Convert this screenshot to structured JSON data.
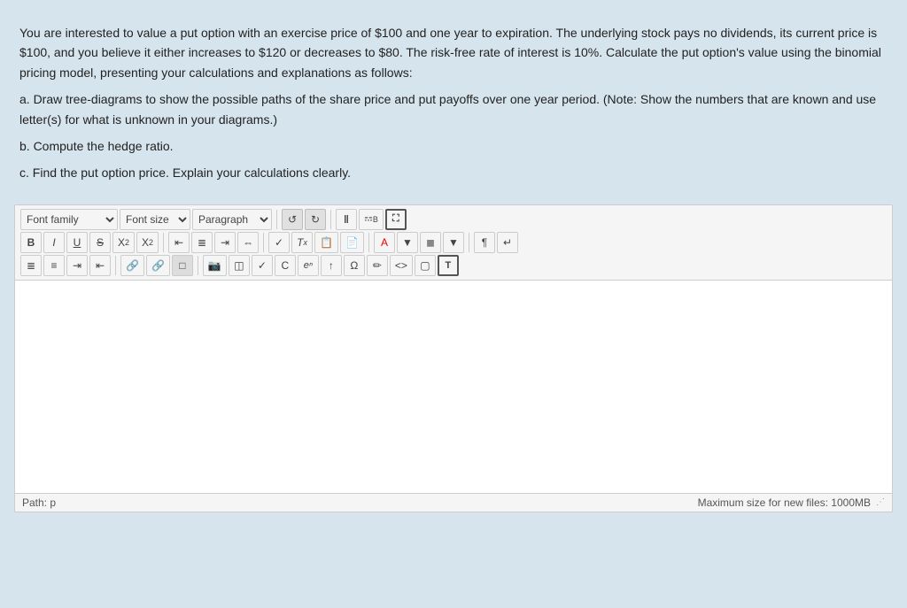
{
  "question": {
    "intro": "You are interested to value a put option with an exercise price of $100 and one year to expiration. The underlying stock pays no dividends, its current price is $100, and you believe it either increases to $120 or decreases to $80. The risk-free rate of interest is 10%. Calculate the put option's value using the binomial pricing model, presenting your calculations and explanations as follows:",
    "part_a": "a. Draw tree-diagrams to show the possible paths of the share price and put payoffs over one year period. (Note: Show the numbers that are known and use letter(s) for what is unknown in your diagrams.)",
    "part_b": "b. Compute the hedge ratio.",
    "part_c": "c. Find the put option price. Explain your calculations clearly.",
    "toolbar": {
      "font_family_label": "Font family",
      "font_size_label": "Font size",
      "paragraph_label": "Paragraph"
    },
    "footer": {
      "path_label": "Path: p",
      "max_size_label": "Maximum size for new files: 1000MB"
    }
  }
}
